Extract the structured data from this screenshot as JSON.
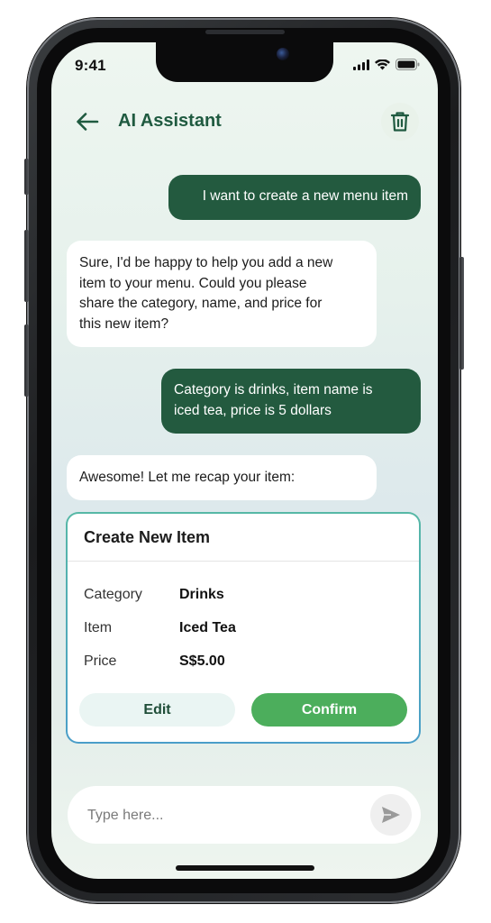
{
  "status_bar": {
    "time": "9:41"
  },
  "header": {
    "title": "AI Assistant",
    "back_icon": "arrow-left-icon",
    "delete_icon": "trash-icon"
  },
  "messages": [
    {
      "role": "user",
      "text": "I want to create a new menu item"
    },
    {
      "role": "assistant",
      "lines": [
        "Sure, I'd be happy to help you add a new",
        "item to your menu. Could you please",
        "share the category, name, and price for",
        "this new item?"
      ]
    },
    {
      "role": "user",
      "lines": [
        "Category is drinks, item name is",
        "iced tea, price is 5 dollars"
      ]
    },
    {
      "role": "assistant",
      "text": "Awesome! Let me recap your item:"
    }
  ],
  "item_card": {
    "title": "Create New Item",
    "fields": [
      {
        "label": "Category",
        "value": "Drinks"
      },
      {
        "label": "Item",
        "value": "Iced Tea"
      },
      {
        "label": "Price",
        "value": "S$5.00"
      }
    ],
    "edit_label": "Edit",
    "confirm_label": "Confirm"
  },
  "composer": {
    "placeholder": "Type here...",
    "send_icon": "send-icon"
  },
  "colors": {
    "brand_dark_green": "#235a3f",
    "title_green": "#1f5a40",
    "confirm_green": "#4cae5c",
    "edit_bg": "#eaf5f3"
  }
}
